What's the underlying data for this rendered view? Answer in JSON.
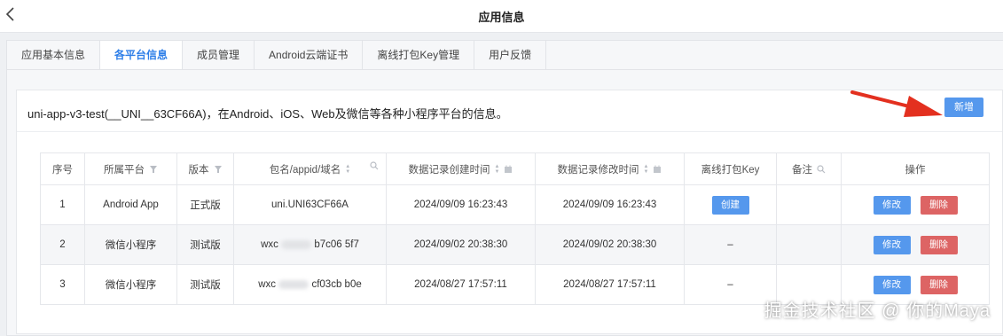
{
  "header": {
    "title": "应用信息"
  },
  "tabs": [
    {
      "label": "应用基本信息"
    },
    {
      "label": "各平台信息"
    },
    {
      "label": "成员管理"
    },
    {
      "label": "Android云端证书"
    },
    {
      "label": "离线打包Key管理"
    },
    {
      "label": "用户反馈"
    }
  ],
  "panel": {
    "description": "uni-app-v3-test(__UNI__63CF66A)，在Android、iOS、Web及微信等各种小程序平台的信息。",
    "add_label": "新增"
  },
  "table": {
    "columns": [
      "序号",
      "所属平台",
      "版本",
      "包名/appid/域名",
      "数据记录创建时间",
      "数据记录修改时间",
      "离线打包Key",
      "备注",
      "操作"
    ],
    "rows": [
      {
        "index": "1",
        "platform": "Android App",
        "version": "正式版",
        "id_pre": "uni.UNI63CF66A",
        "id_post": "",
        "created": "2024/09/09 16:23:43",
        "modified": "2024/09/09 16:23:43",
        "key_label": "创建",
        "key_dash": "",
        "note": "",
        "edit": "修改",
        "delete": "删除"
      },
      {
        "index": "2",
        "platform": "微信小程序",
        "version": "测试版",
        "id_pre": "wxc",
        "id_post": "b7c06  5f7",
        "created": "2024/09/02 20:38:30",
        "modified": "2024/09/02 20:38:30",
        "key_label": "",
        "key_dash": "–",
        "note": "",
        "edit": "修改",
        "delete": "删除"
      },
      {
        "index": "3",
        "platform": "微信小程序",
        "version": "测试版",
        "id_pre": "wxc",
        "id_post": "cf03cb  b0e",
        "created": "2024/08/27 17:57:11",
        "modified": "2024/08/27 17:57:11",
        "key_label": "",
        "key_dash": "–",
        "note": "",
        "edit": "修改",
        "delete": "删除"
      }
    ]
  },
  "watermark": "掘金技术社区 @ 你的Maya",
  "colors": {
    "primary": "#5598ed",
    "danger": "#dd6464",
    "active_tab": "#2f7fe8",
    "arrow": "#e3301f"
  }
}
